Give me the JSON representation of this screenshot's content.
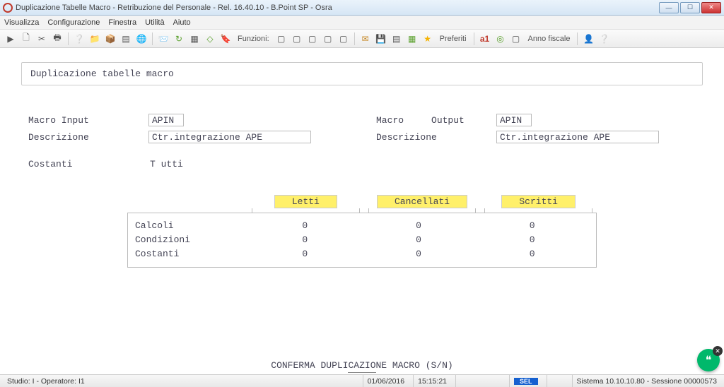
{
  "window": {
    "title": "Duplicazione Tabelle Macro - Retribuzione del Personale - Rel. 16.40.10 - B.Point SP - Osra"
  },
  "menu": {
    "visualizza": "Visualizza",
    "configurazione": "Configurazione",
    "finestra": "Finestra",
    "utilita": "Utilità",
    "aiuto": "Aiuto"
  },
  "toolbar": {
    "funzioni": "Funzioni:",
    "preferiti": "Preferiti",
    "anno_fiscale": "Anno fiscale"
  },
  "header": {
    "title": "Duplicazione tabelle macro"
  },
  "input": {
    "macro_label": "Macro Input",
    "macro_value": "APIN",
    "desc_label": "Descrizione",
    "desc_value": "Ctr.integrazione APE"
  },
  "output": {
    "macro_label": "Macro     Output",
    "macro_value": "APIN",
    "desc_label": "Descrizione",
    "desc_value": "Ctr.integrazione APE"
  },
  "costanti": {
    "label": "Costanti",
    "value": "T utti"
  },
  "grid": {
    "headers": {
      "letti": "Letti",
      "cancellati": "Cancellati",
      "scritti": "Scritti"
    },
    "rows": [
      {
        "name": "Calcoli",
        "letti": "0",
        "cancellati": "0",
        "scritti": "0"
      },
      {
        "name": "Condizioni",
        "letti": "0",
        "cancellati": "0",
        "scritti": "0"
      },
      {
        "name": "Costanti",
        "letti": "0",
        "cancellati": "0",
        "scritti": "0"
      }
    ]
  },
  "confirm": "CONFERMA DUPLICAZIONE MACRO (S/N)",
  "status": {
    "left": "Studio: I - Operatore: I1",
    "date": "01/06/2016",
    "time": "15:15:21",
    "sel": "SEL",
    "right": "Sistema 10.10.10.80 - Sessione 00000573"
  }
}
